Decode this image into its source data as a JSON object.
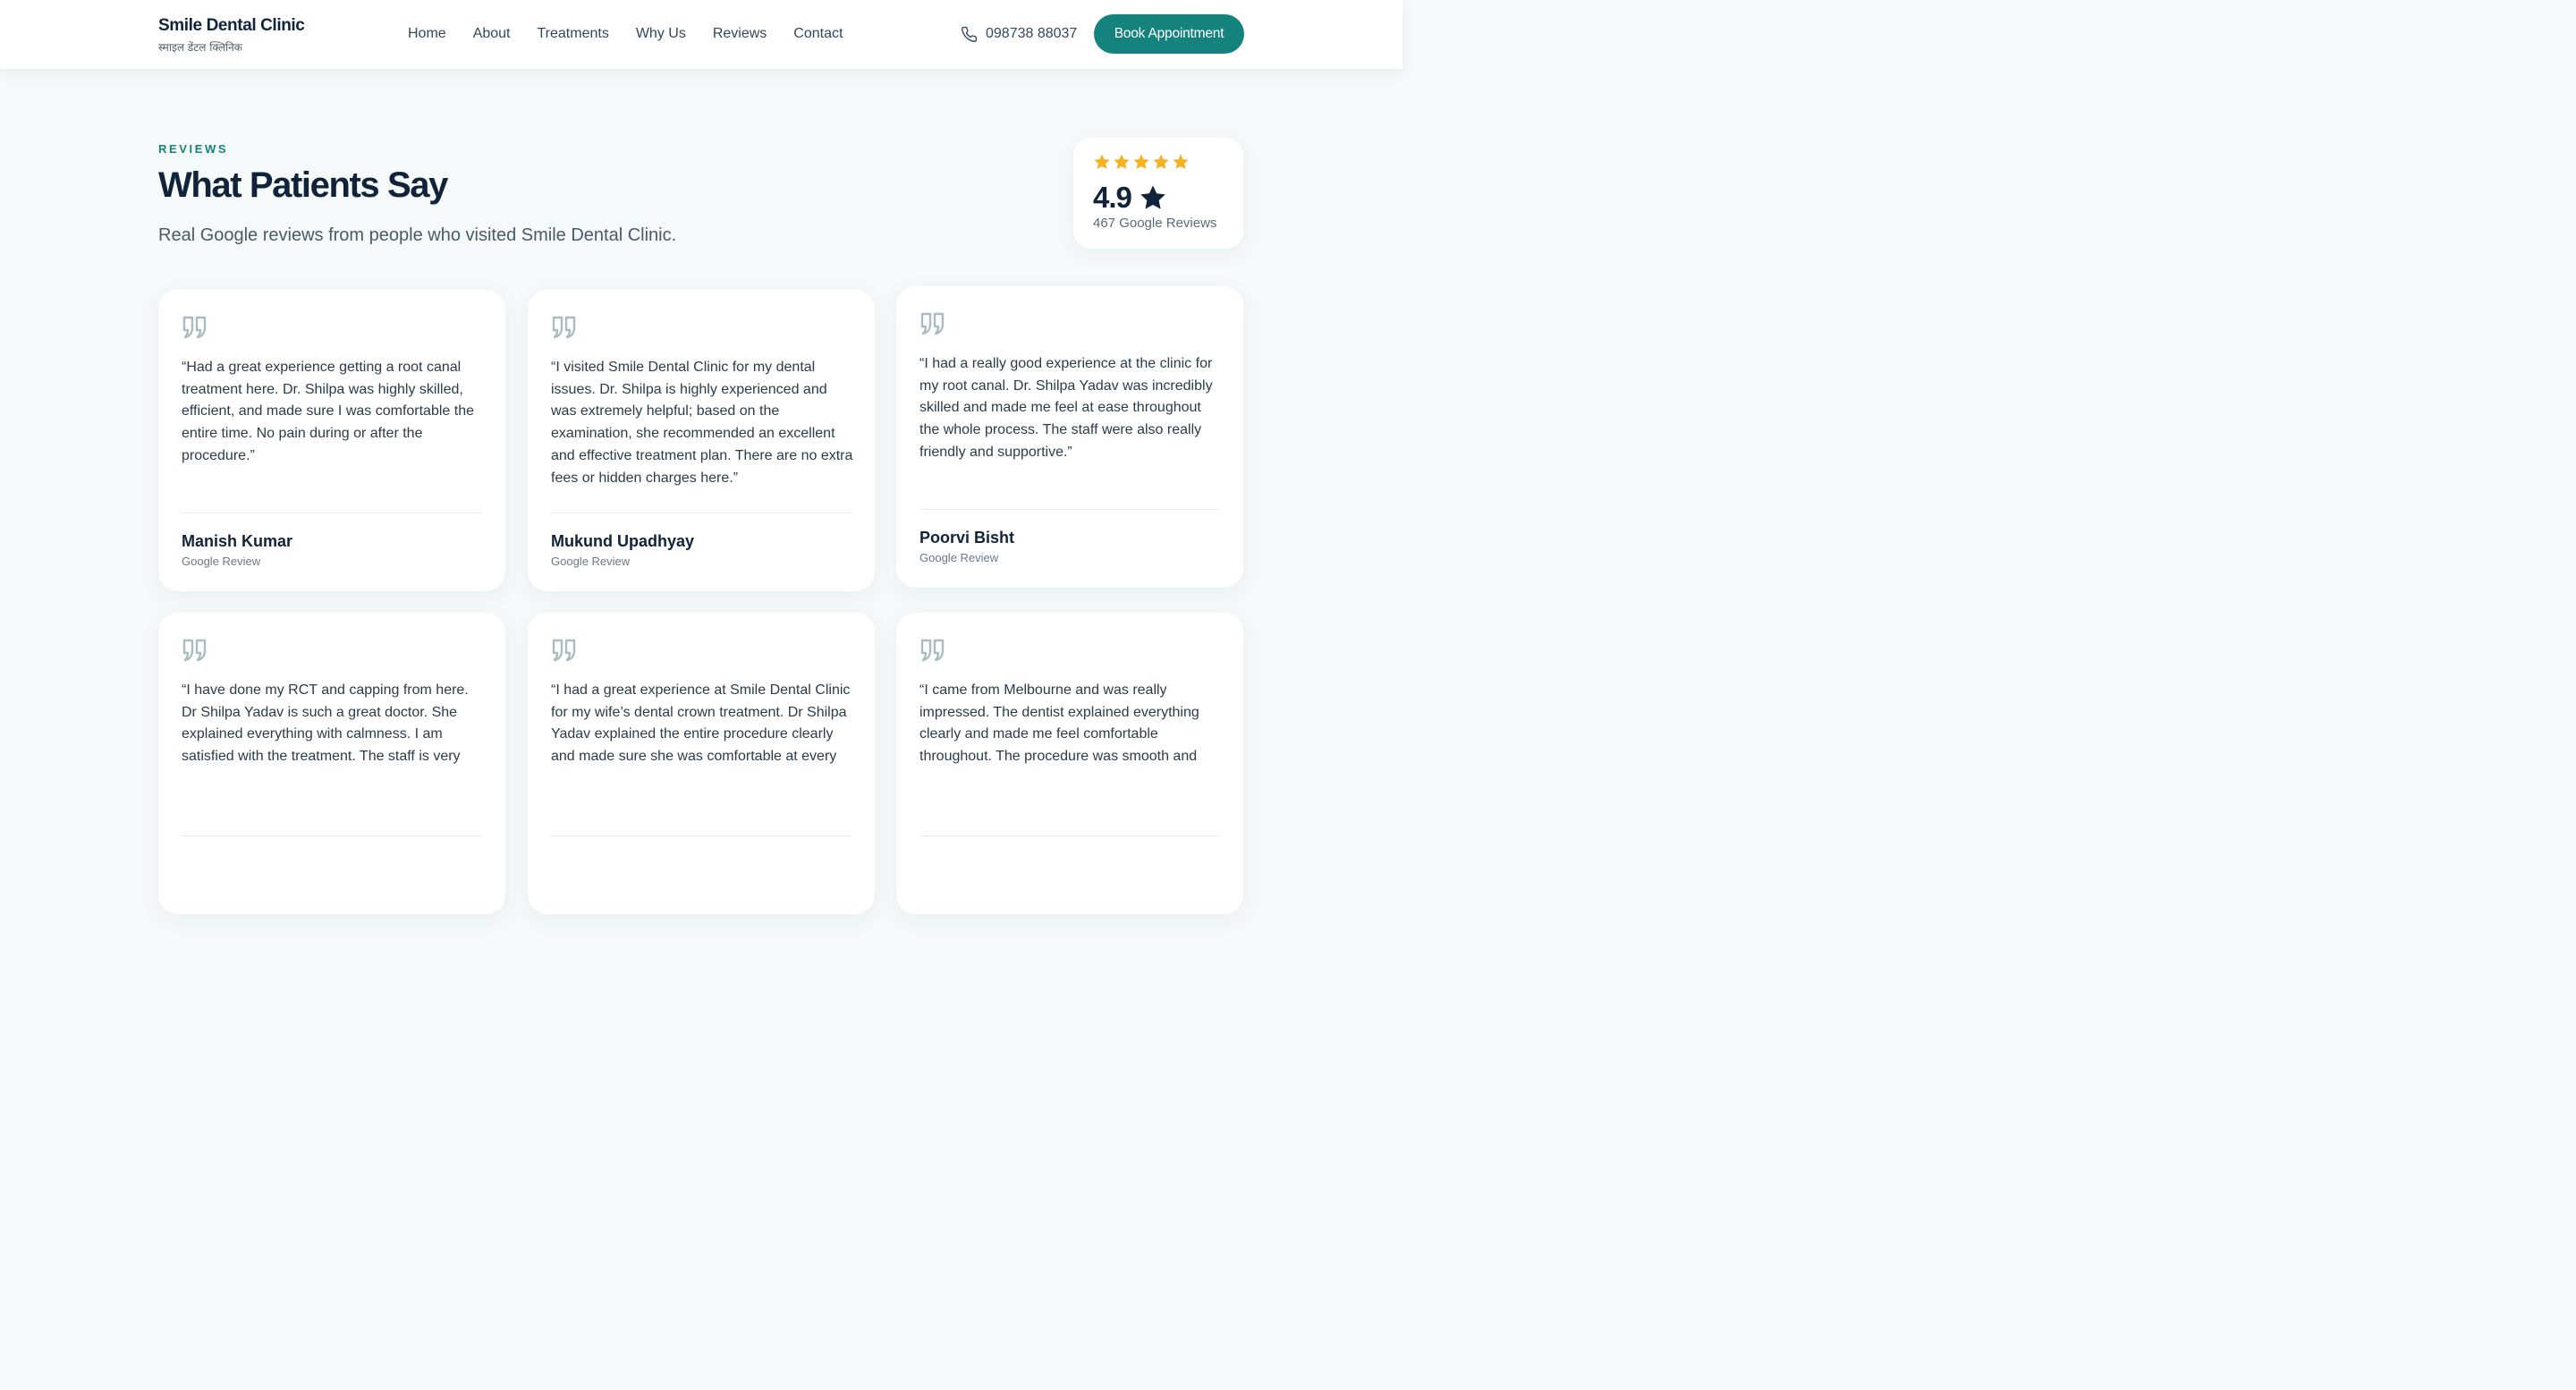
{
  "header": {
    "brand_name": "Smile Dental Clinic",
    "brand_subtitle": "स्माइल डेंटल क्लिनिक",
    "nav": [
      "Home",
      "About",
      "Treatments",
      "Why Us",
      "Reviews",
      "Contact"
    ],
    "phone_icon": "phone-icon",
    "phone": "098738 88037",
    "cta_label": "Book Appointment"
  },
  "section": {
    "eyebrow": "REVIEWS",
    "title": "What Patients Say",
    "subtitle": "Real Google reviews from people who visited Smile Dental Clinic."
  },
  "rating": {
    "stars": 5,
    "value": "4.9",
    "star_icon": "star-icon",
    "count_label": "467 Google Reviews"
  },
  "reviews": [
    {
      "quote": "“Had a great experience getting a root canal treatment here. Dr. Shilpa was highly skilled, efficient, and made sure I was comfortable the entire time. No pain during or after the procedure.”",
      "name": "Manish Kumar",
      "source": "Google Review"
    },
    {
      "quote": "“I visited Smile Dental Clinic for my dental issues. Dr. Shilpa is highly experienced and was extremely helpful; based on the examination, she recommended an excellent and effective treatment plan. There are no extra fees or hidden charges here.”",
      "name": "Mukund Upadhyay",
      "source": "Google Review"
    },
    {
      "quote": "“I had a really good experience at the clinic for my root canal. Dr. Shilpa Yadav was incredibly skilled and made me feel at ease throughout the whole process. The staff were also really friendly and supportive.”",
      "name": "Poorvi Bisht",
      "source": "Google Review"
    },
    {
      "quote": "“I have done my RCT and capping from here. Dr Shilpa Yadav is such a great doctor. She explained everything with calmness. I am satisfied with the treatment. The staff is very",
      "name": "",
      "source": ""
    },
    {
      "quote": "“I had a great experience at Smile Dental Clinic for my wife’s dental crown treatment. Dr Shilpa Yadav explained the entire procedure clearly and made sure she was comfortable at every",
      "name": "",
      "source": ""
    },
    {
      "quote": "“I came from Melbourne and was really impressed. The dentist explained everything clearly and made me feel comfortable throughout. The procedure was smooth and",
      "name": "",
      "source": ""
    }
  ],
  "colors": {
    "accent": "#15837d",
    "star": "#f4b323",
    "page_bg": "#f5f9f9",
    "heading": "#10233a"
  }
}
